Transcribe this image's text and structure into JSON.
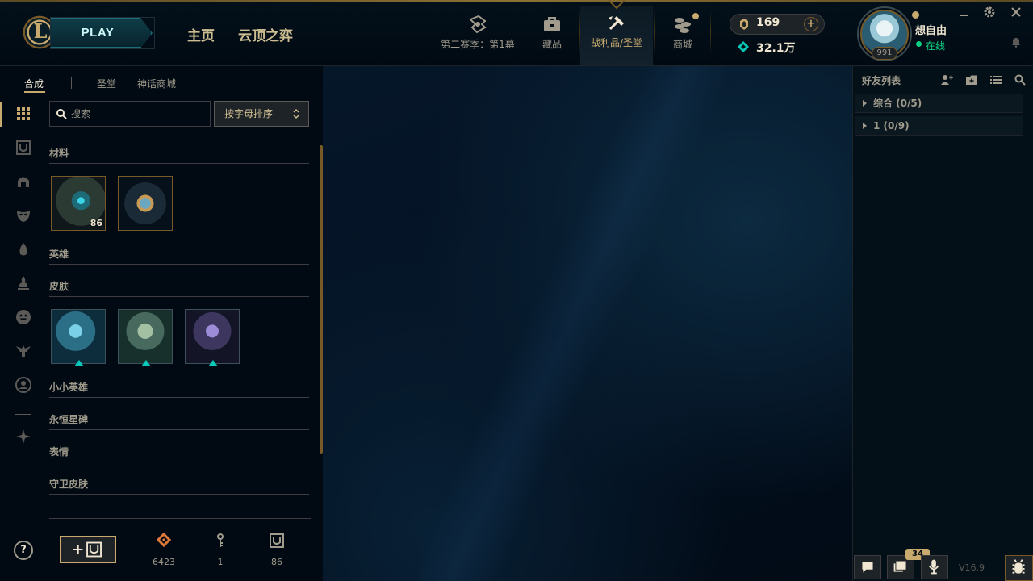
{
  "header": {
    "play_label": "PLAY",
    "nav_home": "主页",
    "nav_tft": "云顶之弈",
    "nav_items": {
      "season": "第二赛季：第1幕",
      "collection": "藏品",
      "loot": "战利品/圣堂",
      "store": "商城"
    },
    "rp": "169",
    "blue_essence": "32.1万",
    "profile": {
      "name": "想自由",
      "status": "在线",
      "level": "991"
    }
  },
  "loot": {
    "tabs": [
      "合成",
      "圣堂",
      "神话商城"
    ],
    "search_placeholder": "搜索",
    "sort_label": "按字母排序",
    "sections": {
      "materials": "材料",
      "champions": "英雄",
      "skins": "皮肤",
      "little_legends": "小小英雄",
      "eternals": "永恒星碑",
      "emotes": "表情",
      "ward_skins": "守卫皮肤"
    },
    "material_items": [
      {
        "name": "chest",
        "count": "86"
      },
      {
        "name": "capsule",
        "count": ""
      }
    ],
    "skin_items": [
      "skin-1",
      "skin-2",
      "skin-3"
    ],
    "currencies": {
      "orange_essence": "6423",
      "keys": "1",
      "chests": "86"
    }
  },
  "friends": {
    "title": "好友列表",
    "groups": [
      "综合 (0/5)",
      "1 (0/9)"
    ]
  },
  "footer": {
    "notification_count": "34",
    "version": "V16.9"
  },
  "colors": {
    "gold": "#c8aa6e",
    "online": "#0acf83",
    "background": "#010a13"
  }
}
